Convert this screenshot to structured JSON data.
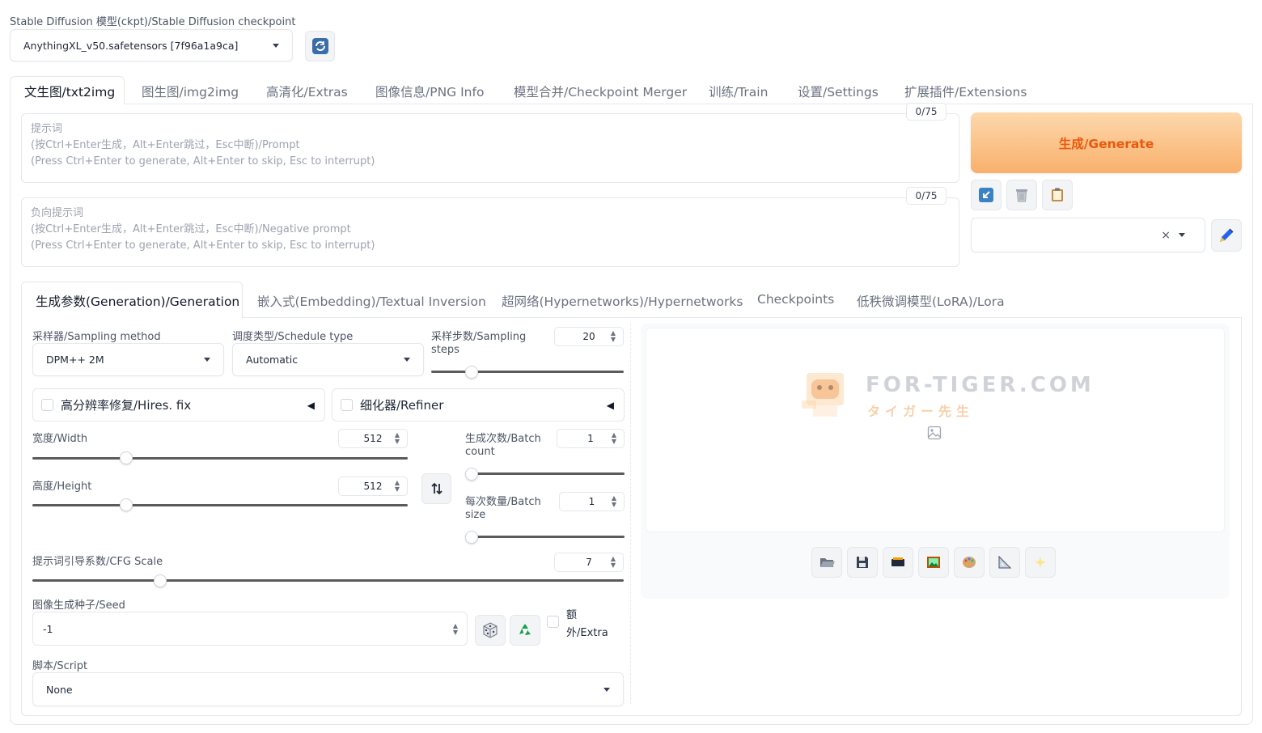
{
  "checkpoint": {
    "label": "Stable Diffusion 模型(ckpt)/Stable Diffusion checkpoint",
    "value": "AnythingXL_v50.safetensors [7f96a1a9ca]",
    "refresh_icon": "refresh-icon"
  },
  "main_tabs": [
    {
      "label": "文生图/txt2img",
      "active": true
    },
    {
      "label": "图生图/img2img"
    },
    {
      "label": "高清化/Extras"
    },
    {
      "label": "图像信息/PNG Info"
    },
    {
      "label": "模型合并/Checkpoint Merger"
    },
    {
      "label": "训练/Train"
    },
    {
      "label": "设置/Settings"
    },
    {
      "label": "扩展插件/Extensions"
    }
  ],
  "prompt": {
    "counter": "0/75",
    "placeholder_lines": [
      "提示词",
      "(按Ctrl+Enter生成，Alt+Enter跳过，Esc中断)/Prompt",
      "(Press Ctrl+Enter to generate, Alt+Enter to skip, Esc to interrupt)"
    ]
  },
  "negative_prompt": {
    "counter": "0/75",
    "placeholder_lines": [
      "负向提示词",
      "(按Ctrl+Enter生成，Alt+Enter跳过，Esc中断)/Negative prompt",
      "(Press Ctrl+Enter to generate, Alt+Enter to skip, Esc to interrupt)"
    ]
  },
  "generate_button": "生成/Generate",
  "style_tools": {
    "icons": [
      "arrow-in-icon",
      "trash-icon",
      "clipboard-icon",
      "pencil-icon"
    ],
    "clear": "×"
  },
  "sub_tabs": [
    {
      "label": "生成参数(Generation)/Generation",
      "active": true
    },
    {
      "label": "嵌入式(Embedding)/Textual Inversion"
    },
    {
      "label": "超网络(Hypernetworks)/Hypernetworks"
    },
    {
      "label": "Checkpoints"
    },
    {
      "label": "低秩微调模型(LoRA)/Lora"
    }
  ],
  "params": {
    "sampler_label": "采样器/Sampling method",
    "sampler_value": "DPM++ 2M",
    "schedule_label": "调度类型/Schedule type",
    "schedule_value": "Automatic",
    "steps_label_1": "采样步数/Sampling",
    "steps_label_2": "steps",
    "steps_value": "20",
    "steps_fraction": 0.19,
    "hires_label": "高分辨率修复/Hires. fix",
    "refiner_label": "细化器/Refiner",
    "width_label": "宽度/Width",
    "width_value": "512",
    "width_fraction": 0.24,
    "height_label": "高度/Height",
    "height_value": "512",
    "height_fraction": 0.24,
    "batch_count_label_1": "生成次数/Batch",
    "batch_count_label_2": "count",
    "batch_count_value": "1",
    "batch_count_fraction": 0.0,
    "batch_size_label_1": "每次数量/Batch",
    "batch_size_label_2": "size",
    "batch_size_value": "1",
    "batch_size_fraction": 0.0,
    "cfg_label": "提示词引导系数/CFG Scale",
    "cfg_value": "7",
    "cfg_fraction": 0.21,
    "seed_label": "图像生成种子/Seed",
    "seed_value": "-1",
    "extra_label_1": "额",
    "extra_label_2": "外/Extra",
    "script_label": "脚本/Script",
    "script_value": "None"
  },
  "watermark": {
    "line1": "FOR-TIGER.COM",
    "line2": "タイガー先生"
  },
  "output_tools": [
    "folder-icon",
    "save-icon",
    "zip-icon",
    "image-icon",
    "palette-icon",
    "ruler-icon",
    "sparkle-icon"
  ]
}
